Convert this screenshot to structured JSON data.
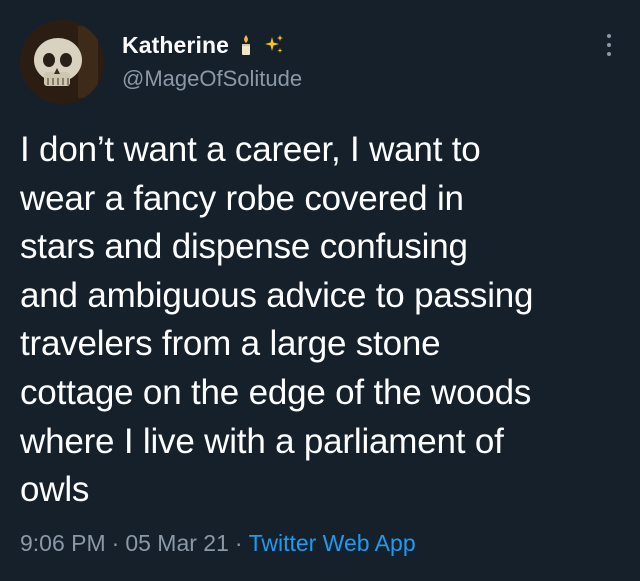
{
  "tweet": {
    "display_name": "Katherine",
    "handle": "@MageOfSolitude",
    "text": "I don’t want a career, I want to\nwear a fancy robe covered in\nstars and dispense confusing\nand ambiguous advice to passing\ntravelers from a large stone\ncottage on the edge of the woods\nwhere I live with a parliament of\nowls",
    "time": "9:06 PM",
    "separator": "·",
    "date": "05 Mar 21",
    "source": "Twitter Web App",
    "name_icons": [
      "candle-icon",
      "sparkles-icon"
    ]
  },
  "colors": {
    "background": "#15202b",
    "text": "#ffffff",
    "muted": "#8b98a5",
    "link": "#1d9bf0"
  }
}
